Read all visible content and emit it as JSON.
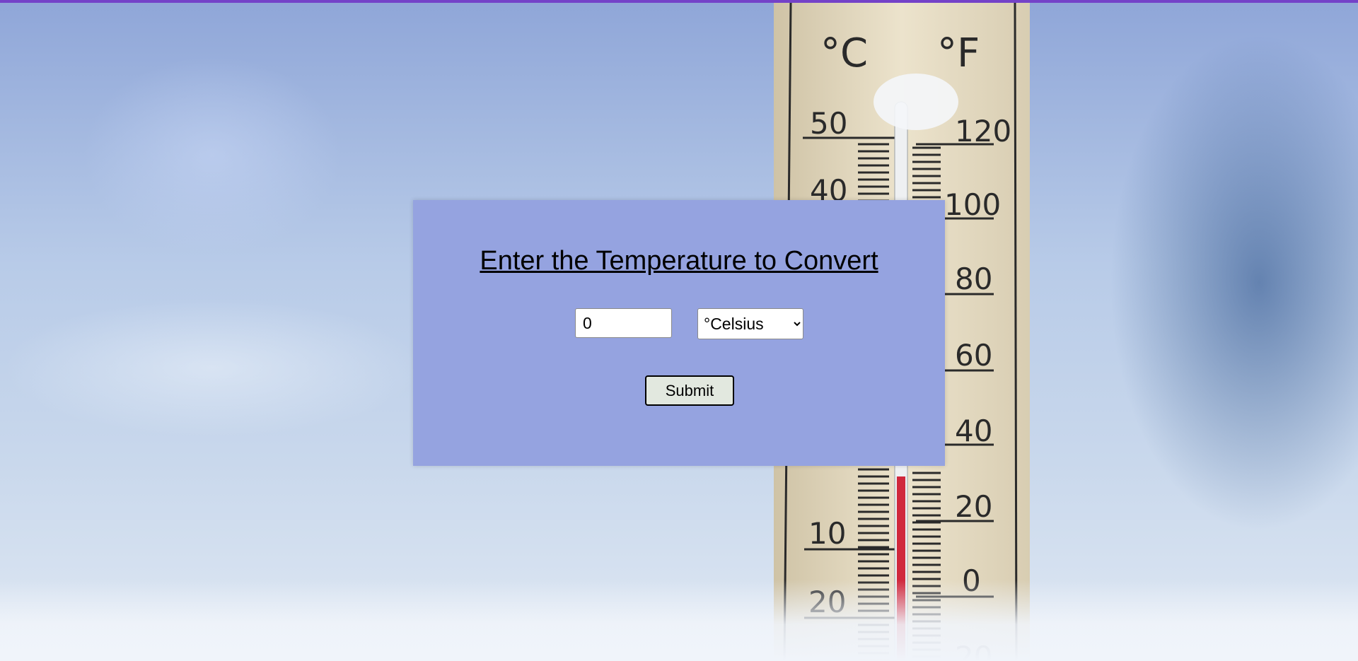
{
  "form": {
    "title": "Enter the Temperature to Convert",
    "temperature_value": "0",
    "unit_selected": "°Celsius",
    "submit_label": "Submit"
  },
  "background": {
    "scale_labels_celsius": [
      "°C",
      "50",
      "40",
      "10",
      "20"
    ],
    "scale_labels_fahrenheit": [
      "°F",
      "120",
      "100",
      "80",
      "60",
      "40",
      "20",
      "0",
      "20"
    ]
  },
  "colors": {
    "top_bar": "#7442c8",
    "panel": "#95a3e0",
    "submit_bg": "#e2e8df",
    "mercury": "#d0283c"
  }
}
